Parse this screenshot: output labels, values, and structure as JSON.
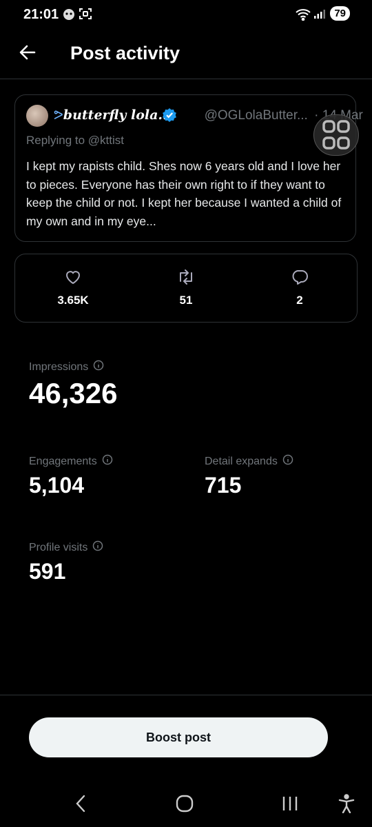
{
  "status": {
    "time": "21:01",
    "battery": "79"
  },
  "header": {
    "title": "Post activity"
  },
  "post": {
    "display_name": "butterfly lola...",
    "handle": "@OGLolaButter...",
    "date": "· 14 Mar",
    "replying_prefix": "Replying to",
    "replying_to": "@kttist",
    "text": "I kept my rapists child. Shes now 6 years old and I love her to pieces. Everyone has their own right to if they want to keep the child or not. I kept her because I wanted a child of my own and in my eye..."
  },
  "engagement": {
    "likes": "3.65K",
    "reposts": "51",
    "replies": "2"
  },
  "metrics": {
    "impressions": {
      "label": "Impressions",
      "value": "46,326"
    },
    "engagements": {
      "label": "Engagements",
      "value": "5,104"
    },
    "detail_expands": {
      "label": "Detail expands",
      "value": "715"
    },
    "profile_visits": {
      "label": "Profile visits",
      "value": "591"
    }
  },
  "boost": {
    "label": "Boost post"
  },
  "colors": {
    "accent": "#1d9bf0",
    "muted": "#71767b",
    "border": "#2f3336",
    "background": "#000000"
  }
}
